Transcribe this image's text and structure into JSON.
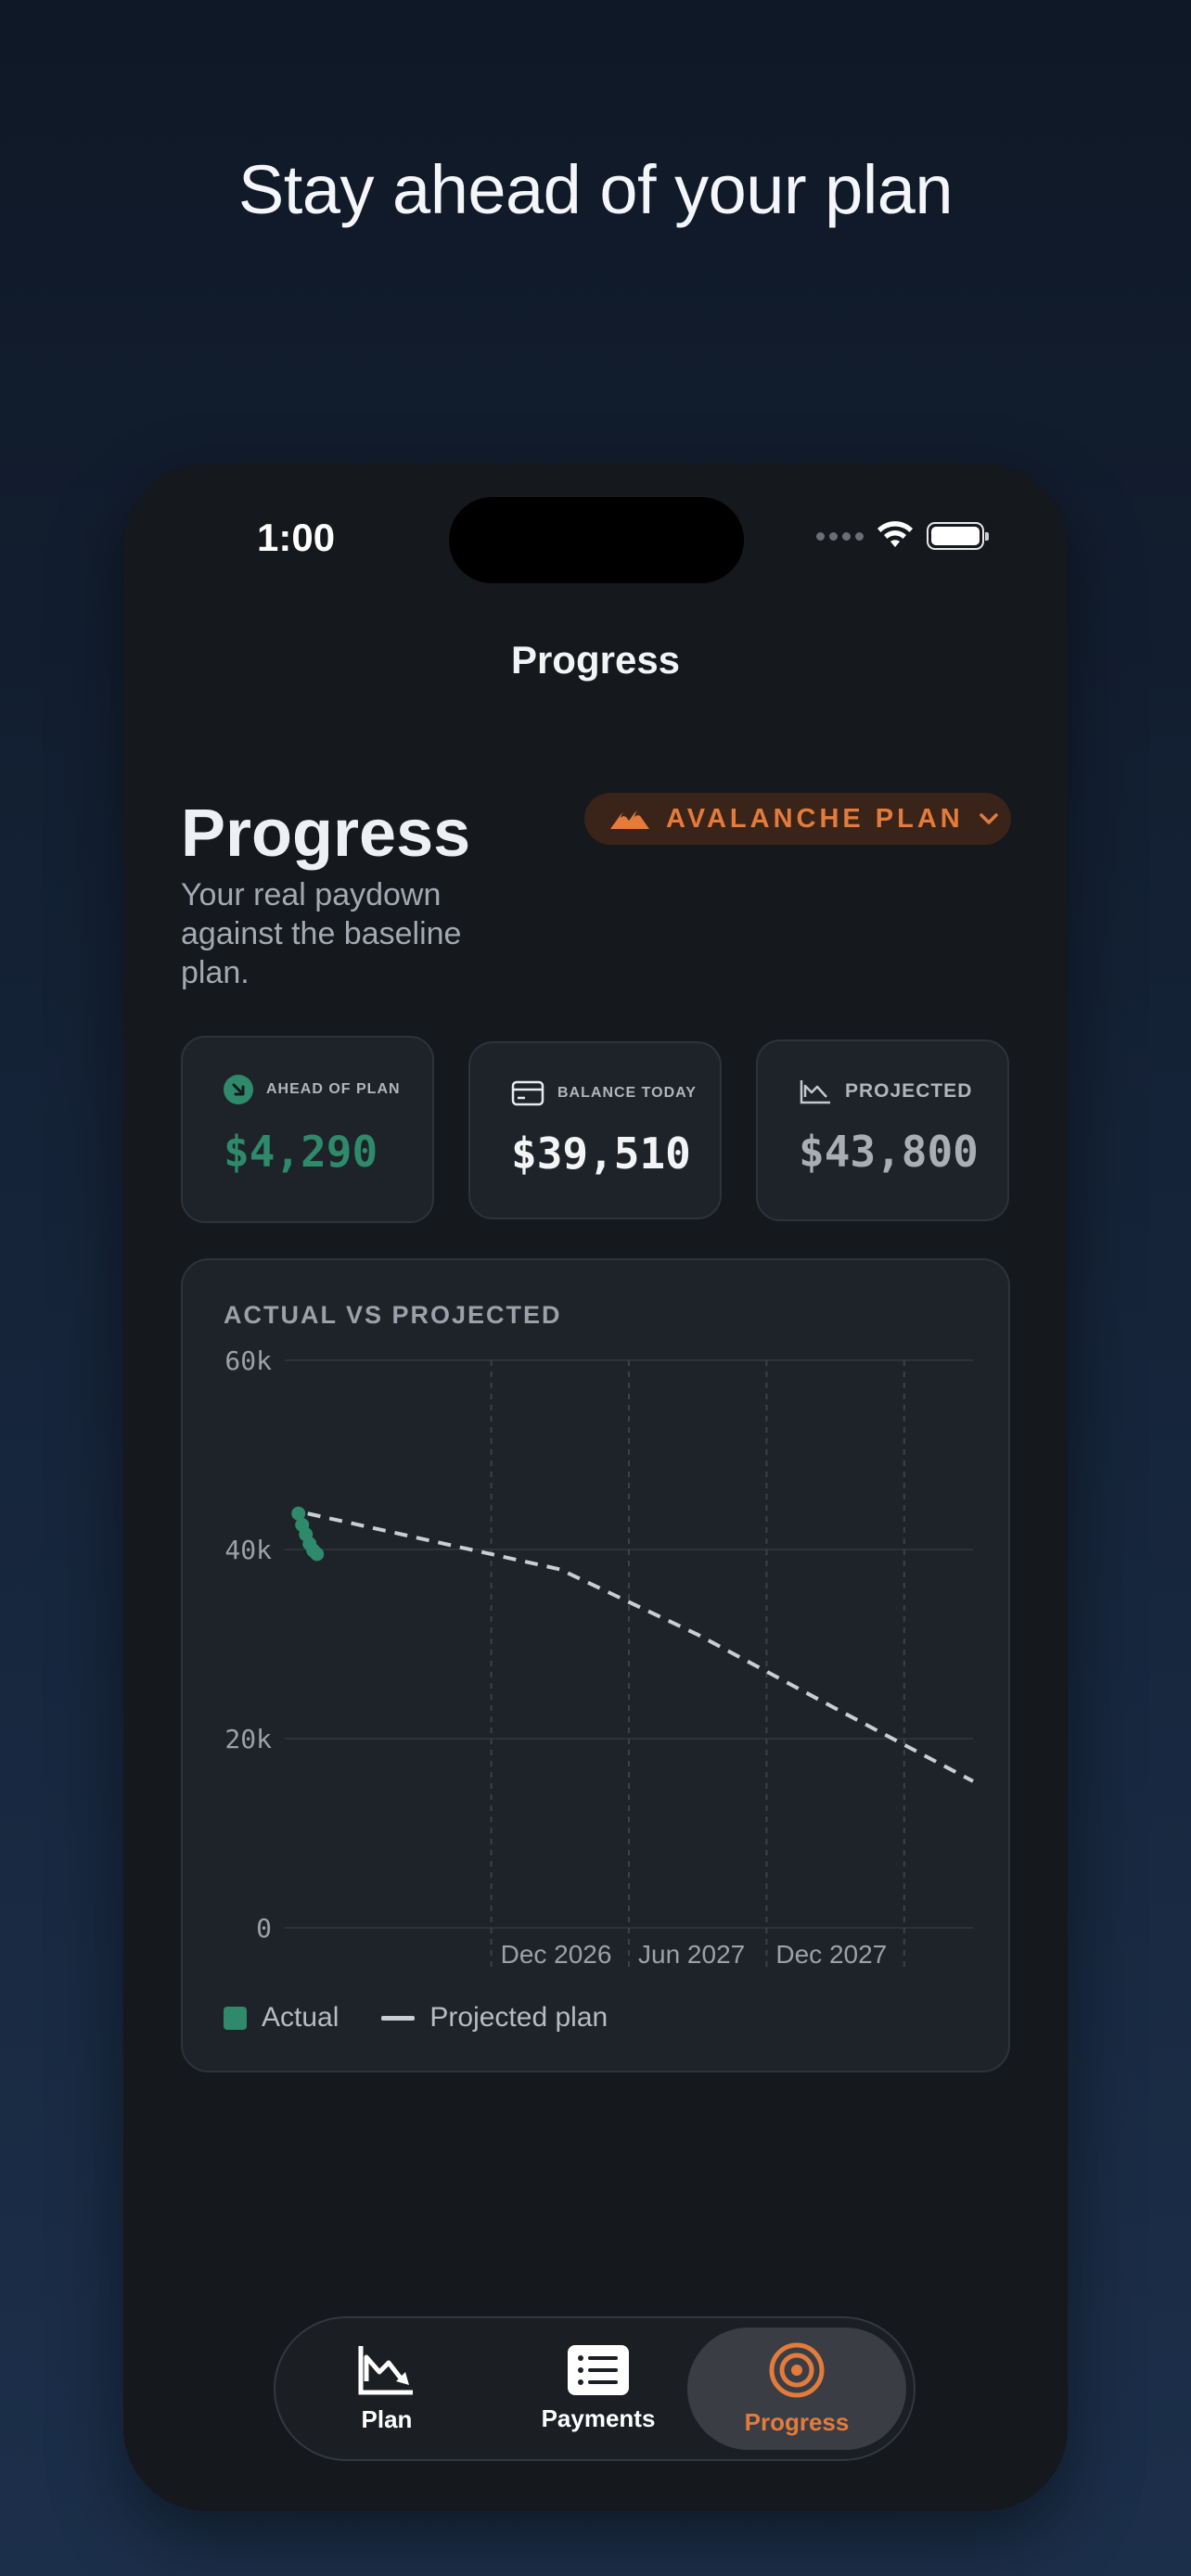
{
  "headline": "Stay ahead of your plan",
  "status": {
    "time": "1:00"
  },
  "nav": {
    "title": "Progress"
  },
  "page": {
    "title": "Progress",
    "subtitle": "Your real paydown against the baseline plan.",
    "plan_selector": "AVALANCHE PLAN"
  },
  "stats": [
    {
      "label": "AHEAD OF PLAN",
      "value": "$4,290",
      "icon": "arrow-down-right-circle-icon",
      "color": "#2e8a6b"
    },
    {
      "label": "BALANCE TODAY",
      "value": "$39,510",
      "icon": "credit-card-icon",
      "color": "#f2f4f6"
    },
    {
      "label": "PROJECTED",
      "value": "$43,800",
      "icon": "chart-down-icon",
      "color": "#a8aeb6"
    }
  ],
  "chart_data": {
    "type": "line",
    "title": "ACTUAL VS PROJECTED",
    "y_ticks": [
      "60k",
      "40k",
      "20k",
      "0"
    ],
    "ylim": [
      0,
      60000
    ],
    "x_ticks": [
      "Dec 2026",
      "Jun 2027",
      "Dec 2027"
    ],
    "series": [
      {
        "name": "Actual",
        "style": "points",
        "color": "#2e8a6b",
        "values": [
          {
            "x": "2026-01",
            "y": 43800
          },
          {
            "x": "2026-01",
            "y": 42600
          },
          {
            "x": "2026-02",
            "y": 41600
          },
          {
            "x": "2026-02",
            "y": 40600
          },
          {
            "x": "2026-03",
            "y": 39900
          },
          {
            "x": "2026-03",
            "y": 39510
          }
        ]
      },
      {
        "name": "Projected plan",
        "style": "dashed-line",
        "color": "#c9ced4",
        "values": [
          {
            "x": "2026-01",
            "y": 43800
          },
          {
            "x": "2026-12",
            "y": 37900
          },
          {
            "x": "2027-06",
            "y": 31000
          },
          {
            "x": "2027-12",
            "y": 23200
          },
          {
            "x": "2028-06",
            "y": 15500
          }
        ]
      }
    ],
    "grid": true,
    "legend": "bottom-left"
  },
  "tabs": [
    {
      "label": "Plan",
      "icon": "chart-down-icon",
      "active": false
    },
    {
      "label": "Payments",
      "icon": "list-icon",
      "active": false
    },
    {
      "label": "Progress",
      "icon": "target-icon",
      "active": true
    }
  ],
  "colors": {
    "accent": "#e37b3d",
    "positive": "#2e8a6b"
  }
}
